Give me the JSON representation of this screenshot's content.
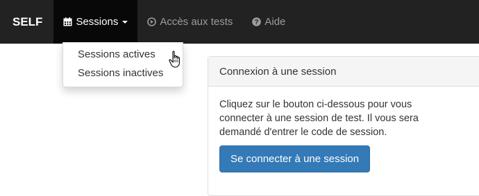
{
  "navbar": {
    "brand": "SELF",
    "sessions_label": "Sessions",
    "tests_label": "Accès aux tests",
    "help_label": "Aide"
  },
  "dropdown": {
    "items": [
      {
        "label": "Sessions actives"
      },
      {
        "label": "Sessions inactives"
      }
    ]
  },
  "panel": {
    "title": "Connexion à une session",
    "body": "Cliquez sur le bouton ci-dessous pour vous connecter à une session de test. Il vous sera demandé d'entrer le code de session.",
    "button_label": "Se connecter à une session"
  },
  "colors": {
    "navbar_bg": "#222222",
    "navbar_active_bg": "#080808",
    "primary": "#337ab7"
  },
  "icons": {
    "sessions": "calendar-icon",
    "tests": "play-circle-icon",
    "help": "question-circle-icon",
    "cursor": "hand-pointer-icon"
  }
}
